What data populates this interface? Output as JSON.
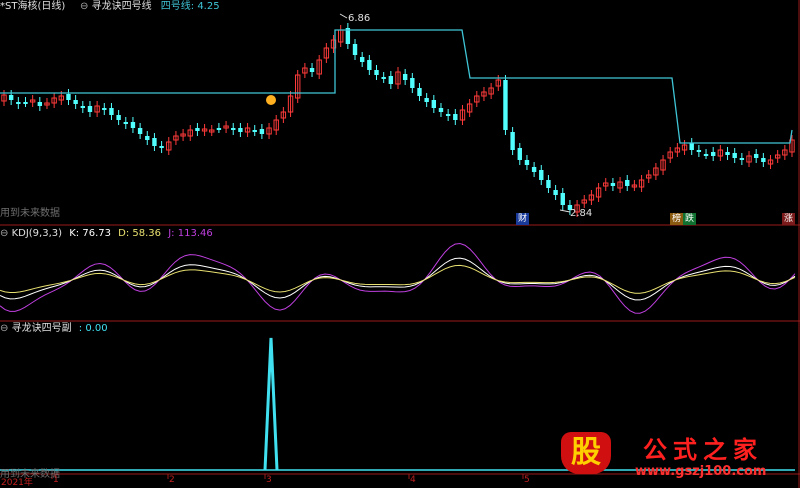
{
  "main_panel": {
    "stock_name": "*ST海核(日线)",
    "indicator": "寻龙诀四号线",
    "series_label": "四号线: 4.25",
    "note": "用到未来数据",
    "high_label": "6.86",
    "low_label": "2.84",
    "markers": [
      "财",
      "榜",
      "跌",
      "涨"
    ]
  },
  "kdj_panel": {
    "title": "KDJ(9,3,3)",
    "k": "K: 76.73",
    "d": "D: 58.36",
    "j": "J: 113.46"
  },
  "sub_panel": {
    "title": "寻龙诀四号副",
    "value": ": 0.00",
    "note": "用到未来数据"
  },
  "x_axis": {
    "labels": [
      "2021年",
      "1",
      "2",
      "3",
      "4",
      "5"
    ]
  },
  "watermark": {
    "logo_text": "股",
    "site_name": "公式之家",
    "url": "www.gszj100.com"
  },
  "colors": {
    "up": "#ff3b3b",
    "down": "#52ffff",
    "step_line": "#3fc5d6",
    "k_line": "#ffffff",
    "d_line": "#e8e070",
    "j_line": "#c040e0",
    "spike": "#40e0f0",
    "axis_red": "#9a1a1a"
  },
  "chart_data": [
    {
      "type": "candlestick",
      "title": "寻龙诀四号线",
      "series": [
        {
          "name": "四号线",
          "values": [
            4.25
          ]
        }
      ],
      "annotations": [
        {
          "text": "6.86",
          "kind": "high"
        },
        {
          "text": "2.84",
          "kind": "low"
        }
      ]
    },
    {
      "type": "line",
      "title": "KDJ(9,3,3)",
      "series": [
        {
          "name": "K",
          "values": [
            76.73
          ]
        },
        {
          "name": "D",
          "values": [
            58.36
          ]
        },
        {
          "name": "J",
          "values": [
            113.46
          ]
        }
      ]
    },
    {
      "type": "line",
      "title": "寻龙诀四号副",
      "series": [
        {
          "name": "寻龙诀四号副",
          "values": [
            0.0
          ]
        }
      ]
    }
  ]
}
